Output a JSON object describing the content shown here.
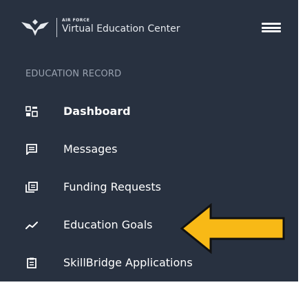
{
  "header": {
    "brand_small": "AIR FORCE",
    "brand_main": "Virtual Education Center",
    "logo_icon": "air-force-wings-icon",
    "menu_icon": "hamburger-menu-icon"
  },
  "sidebar": {
    "section_title": "EDUCATION RECORD",
    "items": [
      {
        "label": "Dashboard",
        "icon": "dashboard-grid-icon",
        "active": true
      },
      {
        "label": "Messages",
        "icon": "message-icon",
        "active": false
      },
      {
        "label": "Funding Requests",
        "icon": "copy-document-icon",
        "active": false
      },
      {
        "label": "Education Goals",
        "icon": "trend-line-icon",
        "active": false
      },
      {
        "label": "SkillBridge Applications",
        "icon": "clipboard-icon",
        "active": false
      }
    ]
  },
  "annotation": {
    "arrow_color": "#f8b916",
    "arrow_icon": "pointer-arrow-icon"
  },
  "colors": {
    "sidebar_background": "#283140",
    "section_text": "#9aa3b1",
    "item_text": "#ffffff"
  }
}
